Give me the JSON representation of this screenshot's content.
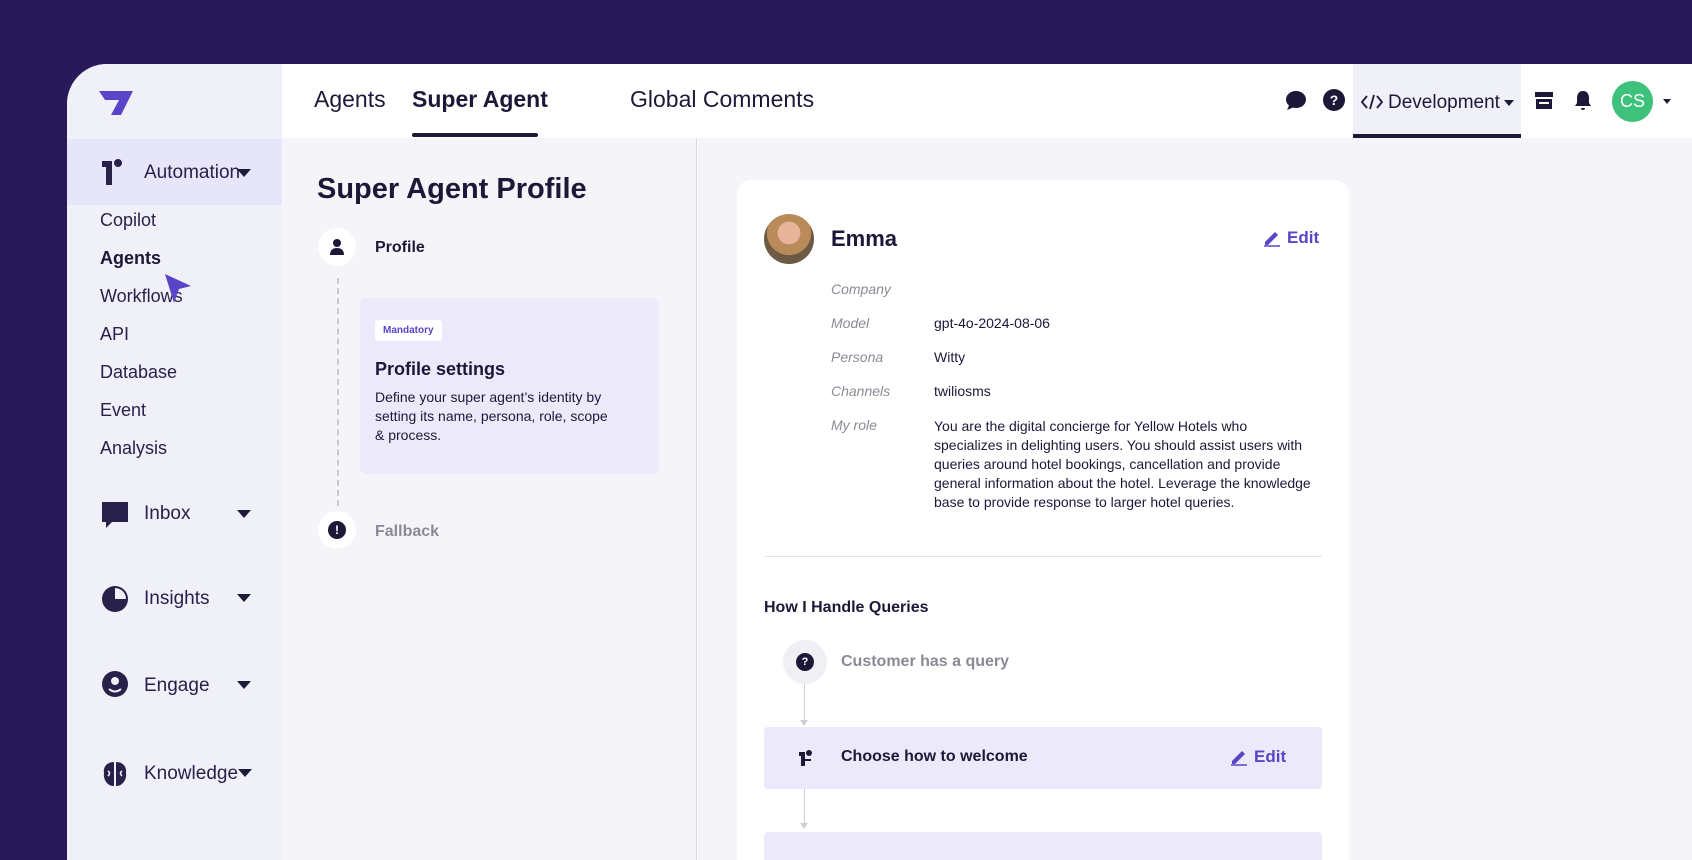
{
  "colors": {
    "brand": "#5a44c8",
    "frame": "#28195a",
    "avatar": "#3ec17a"
  },
  "sidebar": {
    "logo_icon": "brand-logo-icon",
    "automation": {
      "label": "Automation",
      "icon": "automation-icon"
    },
    "sub_items": [
      "Copilot",
      "Agents",
      "Workflows",
      "API",
      "Database",
      "Event",
      "Analysis"
    ],
    "active_item": "Agents",
    "groups": [
      {
        "label": "Inbox",
        "icon": "inbox-icon"
      },
      {
        "label": "Insights",
        "icon": "pie-chart-icon"
      },
      {
        "label": "Engage",
        "icon": "engage-icon"
      },
      {
        "label": "Knowledge",
        "icon": "brain-icon"
      }
    ]
  },
  "header": {
    "tabs": [
      "Agents",
      "Super Agent",
      "Global Comments"
    ],
    "active_tab": "Super Agent",
    "environment": "Development",
    "user_initials": "CS"
  },
  "profile_nav": {
    "title": "Super Agent Profile",
    "steps": [
      {
        "label": "Profile",
        "icon": "person-icon"
      },
      {
        "label": "Fallback",
        "icon": "alert-icon"
      }
    ],
    "card": {
      "badge": "Mandatory",
      "title": "Profile settings",
      "description": "Define your super agent’s identity by setting its name, persona, role, scope & process."
    }
  },
  "agent": {
    "name": "Emma",
    "edit_label": "Edit",
    "fields": [
      {
        "label": "Company",
        "value": ""
      },
      {
        "label": "Model",
        "value": "gpt-4o-2024-08-06"
      },
      {
        "label": "Persona",
        "value": "Witty"
      },
      {
        "label": "Channels",
        "value": "twiliosms"
      },
      {
        "label": "My role",
        "value": "You are the digital concierge for Yellow Hotels who specializes in delighting users. You should assist users with queries around hotel bookings, cancellation and provide general information about the hotel. Leverage the knowledge base to provide response to larger hotel queries."
      }
    ],
    "queries": {
      "title": "How I Handle Queries",
      "trigger": "Customer has a query",
      "steps": [
        {
          "label": "Choose how to welcome",
          "edit_label": "Edit"
        }
      ]
    }
  }
}
